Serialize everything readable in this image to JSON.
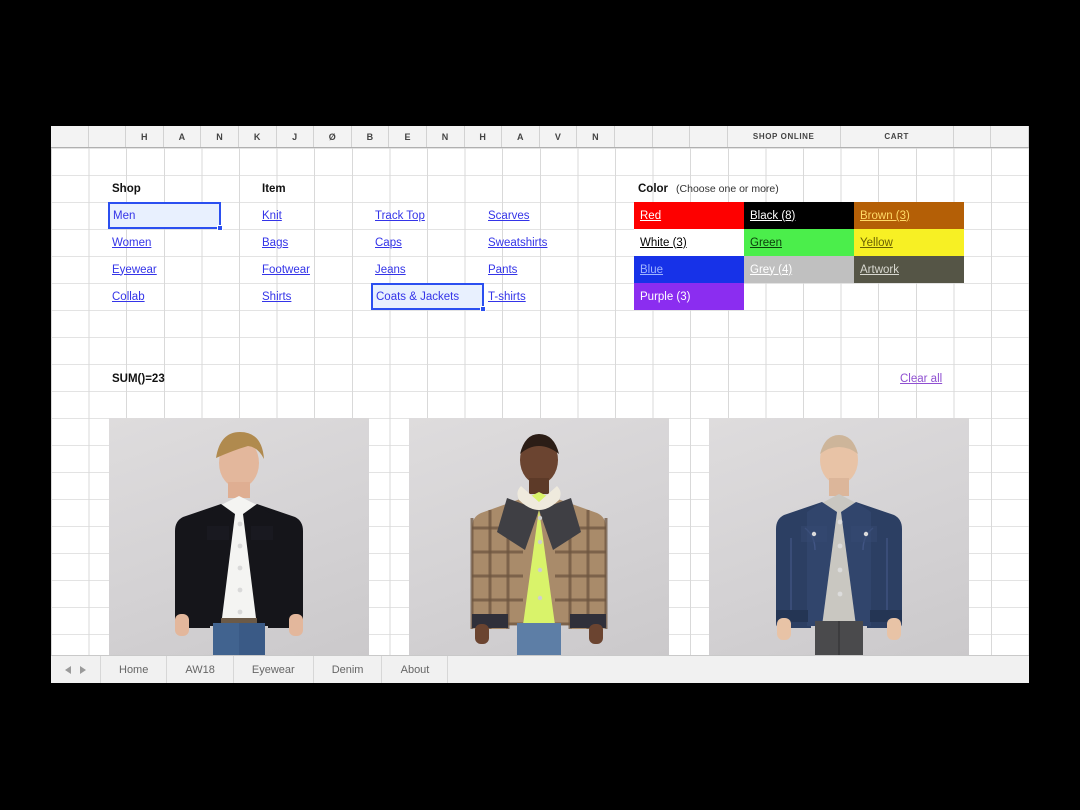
{
  "window": {
    "background_color": "#000000",
    "app_background": "#ffffff"
  },
  "column_headers": [
    {
      "label": ""
    },
    {
      "label": ""
    },
    {
      "label": "H"
    },
    {
      "label": "A"
    },
    {
      "label": "N"
    },
    {
      "label": "K"
    },
    {
      "label": "J"
    },
    {
      "label": "Ø"
    },
    {
      "label": "B"
    },
    {
      "label": "E"
    },
    {
      "label": "N"
    },
    {
      "label": "H"
    },
    {
      "label": "A"
    },
    {
      "label": "V"
    },
    {
      "label": "N"
    },
    {
      "label": ""
    },
    {
      "label": ""
    },
    {
      "label": ""
    },
    {
      "label": "SHOP ONLINE"
    },
    {
      "label": "CART"
    },
    {
      "label": ""
    },
    {
      "label": ""
    }
  ],
  "shop": {
    "heading": "Shop",
    "items": [
      {
        "label": "Men",
        "selected": true
      },
      {
        "label": "Women",
        "selected": false
      },
      {
        "label": "Eyewear",
        "selected": false
      },
      {
        "label": "Collab",
        "selected": false
      }
    ]
  },
  "item": {
    "heading": "Item",
    "column_a": [
      {
        "label": "Knit"
      },
      {
        "label": "Bags"
      },
      {
        "label": "Footwear"
      },
      {
        "label": "Shirts"
      }
    ],
    "column_b": [
      {
        "label": "Track Top",
        "selected": false
      },
      {
        "label": "Caps",
        "selected": false
      },
      {
        "label": "Jeans",
        "selected": false
      },
      {
        "label": "Coats & Jackets",
        "selected": true
      }
    ],
    "column_c": [
      {
        "label": "Scarves"
      },
      {
        "label": "Sweatshirts"
      },
      {
        "label": "Pants"
      },
      {
        "label": "T-shirts"
      }
    ]
  },
  "color": {
    "heading": "Color",
    "hint": "(Choose one or more)",
    "swatches": [
      {
        "label": "Red",
        "bg": "#fe0000",
        "fg": "#ffffff",
        "underline": true,
        "col": 0,
        "row": 0
      },
      {
        "label": "Black (8)",
        "bg": "#000000",
        "fg": "#ffffff",
        "underline": true,
        "col": 1,
        "row": 0
      },
      {
        "label": "Brown (3)",
        "bg": "#b45f06",
        "fg": "#ffd966",
        "underline": true,
        "col": 2,
        "row": 0
      },
      {
        "label": "White (3)",
        "bg": "#ffffff",
        "fg": "#000000",
        "underline": true,
        "col": 0,
        "row": 1
      },
      {
        "label": "Green",
        "bg": "#4bee4b",
        "fg": "#0b3d0b",
        "underline": true,
        "col": 1,
        "row": 1
      },
      {
        "label": "Yellow",
        "bg": "#f7f024",
        "fg": "#6b6102",
        "underline": true,
        "col": 2,
        "row": 1
      },
      {
        "label": "Blue",
        "bg": "#1732e8",
        "fg": "#9fb4ff",
        "underline": true,
        "col": 0,
        "row": 2
      },
      {
        "label": "Grey (4)",
        "bg": "#c0c0c0",
        "fg": "#ffffff",
        "underline": true,
        "col": 1,
        "row": 2
      },
      {
        "label": "Artwork",
        "bg": "#555546",
        "fg": "#d8d8d0",
        "underline": true,
        "col": 2,
        "row": 2
      },
      {
        "label": "Purple (3)",
        "bg": "#8b2df0",
        "fg": "#ffffff",
        "underline": false,
        "col": 0,
        "row": 3
      }
    ]
  },
  "summary": {
    "formula": "SUM()=23",
    "clear_all": "Clear all"
  },
  "products": [
    {
      "alt": "Model in black denim jacket, white t-shirt and blue jeans",
      "jacket_color": "#15151a",
      "inner_color": "#f4f4f2",
      "trouser_color": "#3a5a86",
      "hair_color": "#b08a4e",
      "skin_color": "#e3b79c"
    },
    {
      "alt": "Model in brown checked overshirt with sherpa collar and neon hoodie",
      "jacket_color": "#a98b6a",
      "inner_color": "#d9f36a",
      "trouser_color": "#5d7ea6",
      "hair_color": "#2b1d16",
      "skin_color": "#6b4430"
    },
    {
      "alt": "Model in indigo denim jacket, grey t-shirt and grey trousers",
      "jacket_color": "#2c3f63",
      "inner_color": "#c9c7c1",
      "trouser_color": "#4a4a4c",
      "hair_color": "#cdb59a",
      "skin_color": "#e8c3a6"
    }
  ],
  "sheet_tabs": {
    "prev_label": "previous-sheet",
    "next_label": "next-sheet",
    "tabs": [
      {
        "label": "Home"
      },
      {
        "label": "AW18"
      },
      {
        "label": "Eyewear"
      },
      {
        "label": "Denim"
      },
      {
        "label": "About"
      }
    ]
  }
}
